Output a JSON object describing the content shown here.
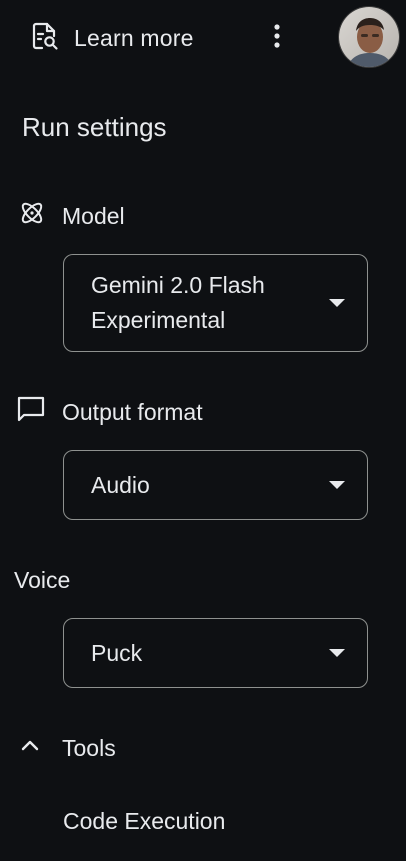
{
  "header": {
    "learn_more_label": "Learn more",
    "learn_more_icon": "doc-search-icon",
    "menu_icon": "more-vert-icon",
    "avatar_icon": "user-avatar"
  },
  "run_settings": {
    "title": "Run settings",
    "model": {
      "label": "Model",
      "icon": "atom-icon",
      "selected": "Gemini 2.0 Flash Experimental"
    },
    "output_format": {
      "label": "Output format",
      "icon": "chat-bubble-icon",
      "selected": "Audio"
    },
    "voice": {
      "label": "Voice",
      "selected": "Puck"
    },
    "tools": {
      "label": "Tools",
      "icon": "chevron-up-icon",
      "expanded": true,
      "items": [
        "Code Execution"
      ]
    }
  },
  "colors": {
    "background": "#0e1013",
    "text": "#e8eaed",
    "border": "#8e918f"
  }
}
